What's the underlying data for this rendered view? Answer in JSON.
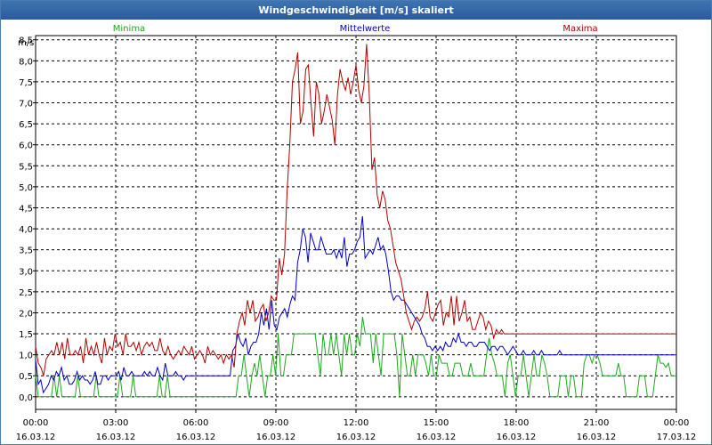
{
  "title": "Windgeschwindigkeit [m/s] skaliert",
  "chart_data": {
    "type": "line",
    "title": "Windgeschwindigkeit [m/s] skaliert",
    "ylabel": "m/s",
    "xlabel": "",
    "ylim": [
      -0.3,
      8.6
    ],
    "xlim": [
      0,
      24
    ],
    "yticks": [
      "0,0",
      "0,5",
      "1,0",
      "1,5",
      "2,0",
      "2,5",
      "3,0",
      "3,5",
      "4,0",
      "4,5",
      "5,0",
      "5,5",
      "6,0",
      "6,5",
      "7,0",
      "7,5",
      "8,0",
      "8,5"
    ],
    "xticks": [
      {
        "time": "00:00",
        "date": "16.03.12"
      },
      {
        "time": "03:00",
        "date": "16.03.12"
      },
      {
        "time": "06:00",
        "date": "16.03.12"
      },
      {
        "time": "09:00",
        "date": "16.03.12"
      },
      {
        "time": "12:00",
        "date": "16.03.12"
      },
      {
        "time": "15:00",
        "date": "16.03.12"
      },
      {
        "time": "18:00",
        "date": "16.03.12"
      },
      {
        "time": "21:00",
        "date": "16.03.12"
      },
      {
        "time": "00:00",
        "date": "17.03.12"
      }
    ],
    "grid": true,
    "legend_position": "top",
    "series": [
      {
        "name": "Minima",
        "color": "#1ea81e",
        "values": [
          0.5,
          0,
          0,
          0,
          0,
          0,
          0,
          0.5,
          0,
          0.5,
          0,
          0,
          0,
          0,
          0,
          0,
          0.5,
          0,
          0,
          0,
          0,
          0,
          0,
          0.5,
          0,
          0,
          0,
          0,
          0,
          0,
          0,
          0,
          0.5,
          0,
          0,
          0,
          0,
          0.5,
          0,
          0,
          0,
          0,
          0,
          0,
          0,
          0,
          0,
          0.5,
          0,
          0,
          0.5,
          0,
          0,
          0,
          0,
          0,
          0,
          0,
          0,
          0,
          0,
          0,
          0,
          0,
          0,
          0,
          0,
          0,
          0,
          0,
          0,
          0,
          0,
          0,
          0,
          0,
          0,
          0.5,
          0.5,
          1.0,
          0.5,
          0,
          0.5,
          0.8,
          0.5,
          1.0,
          0.5,
          0,
          0.5,
          0.5,
          1.0,
          0.5,
          1.5,
          0.5,
          0.5,
          1.0,
          1.0,
          1.0,
          1.5,
          1.5,
          1.5,
          1.5,
          1.5,
          1.5,
          1.5,
          1.5,
          1.5,
          1.0,
          0.5,
          1.5,
          1.0,
          1.0,
          1.5,
          1.0,
          1.5,
          1.0,
          0.5,
          1.5,
          1.0,
          1.5,
          1.0,
          1.0,
          1.5,
          1.2,
          1.9,
          1.5,
          1.5,
          1.5,
          0.8,
          1.5,
          1.0,
          0.5,
          1.5,
          1.5,
          1.5,
          1.5,
          1.5,
          1.0,
          0,
          1.5,
          1.0,
          0.5,
          0.5,
          1.0,
          0.5,
          1.0,
          1.0,
          1.0,
          0.8,
          0.5,
          1.0,
          0.5,
          0.5,
          1.0,
          0.8,
          0.8,
          0.8,
          0.5,
          0.5,
          0.8,
          0.8,
          0.8,
          0.5,
          0.5,
          0.5,
          0.8,
          0.5,
          0.5,
          0.5,
          0.5,
          0.5,
          1.0,
          1.4,
          1.0,
          0.8,
          0.5,
          0.5,
          0.5,
          0,
          0.8,
          1.0,
          0.5,
          0,
          0.5,
          0.5,
          1.0,
          0.5,
          0,
          0.5,
          1.0,
          0.5,
          0.5,
          1.0,
          0.8,
          0.5,
          0,
          0,
          0,
          0,
          0.5,
          0.5,
          0.5,
          0,
          0.5,
          0.5,
          0,
          0,
          0,
          0.8,
          1.0,
          1.0,
          0.8,
          1.0,
          1.0,
          0.8,
          0.5,
          0.5,
          0.5,
          0.5,
          0.5,
          0.5,
          0.8,
          0.5,
          0.5,
          0,
          0,
          0,
          0,
          0,
          0.5,
          0.5,
          0.5,
          0,
          0,
          0,
          0.5,
          1.0,
          0.8,
          0.8,
          0.7,
          0.8,
          0.5,
          0.5,
          0.5
        ]
      },
      {
        "name": "Mittelwerte",
        "color": "#0000c8",
        "values": [
          0.9,
          0.3,
          0.4,
          0.1,
          0.2,
          0.3,
          0.5,
          0.4,
          0.6,
          0.5,
          0.7,
          0.4,
          0.5,
          0.3,
          0.3,
          0.4,
          0.6,
          0.4,
          0.5,
          0.4,
          0.4,
          0.3,
          0.4,
          0.6,
          0.3,
          0.3,
          0.5,
          0.5,
          0.4,
          0.5,
          0.5,
          0.5,
          0.6,
          0.4,
          0.7,
          0.5,
          0.5,
          0.6,
          0.5,
          0.5,
          0.5,
          0.5,
          0.6,
          0.5,
          0.6,
          0.5,
          0.5,
          0.7,
          0.5,
          0.4,
          0.8,
          0.5,
          0.5,
          0.5,
          0.6,
          0.5,
          0.5,
          0.4,
          0.5,
          0.5,
          0.5,
          0.5,
          0.5,
          0.5,
          0.5,
          0.5,
          0.5,
          0.5,
          0.5,
          0.5,
          0.5,
          0.5,
          0.5,
          0.5,
          0.5,
          0.5,
          1.1,
          1.2,
          1.5,
          1.3,
          1.2,
          1.4,
          1.0,
          1.2,
          1.3,
          1.3,
          1.5,
          2.0,
          1.7,
          2.1,
          1.6,
          2.3,
          1.7,
          1.6,
          1.9,
          2.0,
          2.1,
          1.9,
          2.2,
          2.4,
          2.3,
          3.2,
          3.5,
          4.0,
          3.8,
          3.2,
          3.9,
          3.7,
          3.5,
          3.5,
          3.8,
          3.6,
          3.4,
          3.4,
          3.4,
          3.5,
          3.3,
          3.5,
          3.3,
          3.8,
          3.1,
          3.4,
          3.4,
          3.5,
          3.7,
          3.8,
          4.3,
          3.3,
          3.4,
          3.5,
          3.4,
          3.6,
          3.8,
          3.5,
          3.6,
          3.4,
          3.0,
          2.5,
          2.3,
          2.4,
          2.4,
          2.3,
          2.3,
          2.2,
          2.1,
          2.0,
          1.9,
          1.8,
          1.7,
          1.5,
          1.4,
          1.2,
          1.2,
          1.1,
          1.2,
          1.1,
          1.2,
          1.1,
          1.3,
          1.2,
          1.2,
          1.4,
          1.3,
          1.5,
          1.3,
          1.3,
          1.2,
          1.3,
          1.3,
          1.2,
          1.2,
          1.3,
          1.3,
          1.3,
          1.2,
          1.1,
          1.2,
          1.2,
          1.1,
          1.2,
          1.2,
          1.1,
          1.0,
          1.1,
          1.2,
          1.1,
          1.0,
          1.0,
          1.1,
          1.0,
          1.0,
          1.0,
          1.1,
          1.0,
          1.0,
          1.1,
          1.0,
          1.0,
          1.0,
          1.0,
          1.0,
          1.0,
          1.1,
          1.0,
          1.0,
          1.0,
          1.0,
          1.0,
          1.0,
          1.0,
          1.0,
          1.0,
          1.0,
          1.0,
          1.0,
          1.0,
          1.0,
          1.0,
          1.0,
          1.0,
          1.0,
          1.0,
          1.0,
          1.0,
          1.0,
          1.0,
          1.0,
          1.0,
          1.0,
          1.0,
          1.0,
          1.0,
          1.0,
          1.0,
          1.0,
          1.0,
          1.0,
          1.0,
          1.0,
          1.0,
          1.0,
          1.0,
          1.0,
          1.0,
          1.0,
          1.0,
          1.0,
          1.0
        ]
      },
      {
        "name": "Maxima",
        "color": "#b40000",
        "values": [
          1.2,
          0.8,
          0.7,
          0.5,
          0.9,
          1.0,
          1.1,
          1.0,
          1.3,
          1.0,
          1.3,
          0.9,
          1.4,
          1.0,
          1.0,
          1.1,
          1.0,
          1.2,
          0.8,
          1.4,
          1.0,
          1.2,
          1.0,
          1.3,
          1.0,
          0.8,
          1.4,
          1.0,
          1.2,
          1.1,
          1.5,
          1.2,
          1.3,
          1.0,
          1.5,
          1.2,
          1.2,
          1.3,
          1.1,
          1.3,
          1.0,
          1.2,
          1.3,
          1.2,
          1.3,
          1.1,
          1.1,
          1.4,
          1.1,
          1.0,
          1.2,
          1.0,
          0.9,
          1.0,
          1.1,
          1.0,
          1.2,
          1.1,
          1.0,
          1.2,
          0.9,
          1.0,
          1.1,
          1.0,
          0.8,
          1.2,
          1.0,
          1.1,
          1.0,
          0.9,
          1.0,
          0.8,
          1.0,
          0.9,
          1.0,
          0.7,
          1.5,
          1.8,
          2.0,
          1.7,
          2.3,
          2.0,
          2.3,
          1.8,
          1.9,
          2.1,
          2.2,
          1.8,
          2.0,
          2.4,
          2.3,
          2.3,
          3.3,
          2.9,
          3.4,
          4.9,
          6.0,
          7.5,
          7.8,
          8.2,
          6.5,
          6.8,
          7.8,
          7.9,
          7.0,
          6.2,
          7.5,
          7.2,
          6.5,
          6.8,
          7.2,
          6.9,
          6.6,
          6.0,
          7.2,
          7.8,
          7.5,
          7.3,
          7.6,
          7.2,
          7.5,
          7.9,
          7.3,
          7.0,
          7.4,
          8.4,
          7.2,
          5.4,
          5.7,
          4.8,
          4.5,
          4.9,
          4.7,
          4.2,
          4.0,
          3.6,
          3.2,
          3.0,
          2.8,
          2.4,
          2.0,
          1.8,
          1.6,
          1.8,
          1.9,
          1.8,
          1.9,
          2.1,
          2.5,
          1.9,
          1.8,
          2.0,
          2.2,
          2.3,
          1.7,
          2.0,
          1.9,
          2.4,
          1.7,
          2.4,
          1.8,
          2.0,
          2.3,
          1.8,
          1.9,
          1.6,
          1.6,
          1.8,
          2.0,
          1.9,
          1.6,
          1.8,
          1.7,
          1.4,
          1.6,
          1.5,
          1.6,
          1.5,
          1.5,
          1.5,
          1.5,
          1.5,
          1.5,
          1.5,
          1.5,
          1.5,
          1.5,
          1.5,
          1.5,
          1.5,
          1.5,
          1.5,
          1.5,
          1.5,
          1.5,
          1.5,
          1.5,
          1.5,
          1.5,
          1.5,
          1.5,
          1.5,
          1.5,
          1.5,
          1.5,
          1.5,
          1.5,
          1.5,
          1.5,
          1.5,
          1.5,
          1.5,
          1.5,
          1.5,
          1.5,
          1.5,
          1.5,
          1.5,
          1.5,
          1.5,
          1.5,
          1.5,
          1.5,
          1.5,
          1.5,
          1.5,
          1.5,
          1.5,
          1.5,
          1.5,
          1.5,
          1.5,
          1.5,
          1.5,
          1.5,
          1.5,
          1.5,
          1.5,
          1.5,
          1.5,
          1.5,
          1.5,
          1.5
        ]
      }
    ]
  }
}
